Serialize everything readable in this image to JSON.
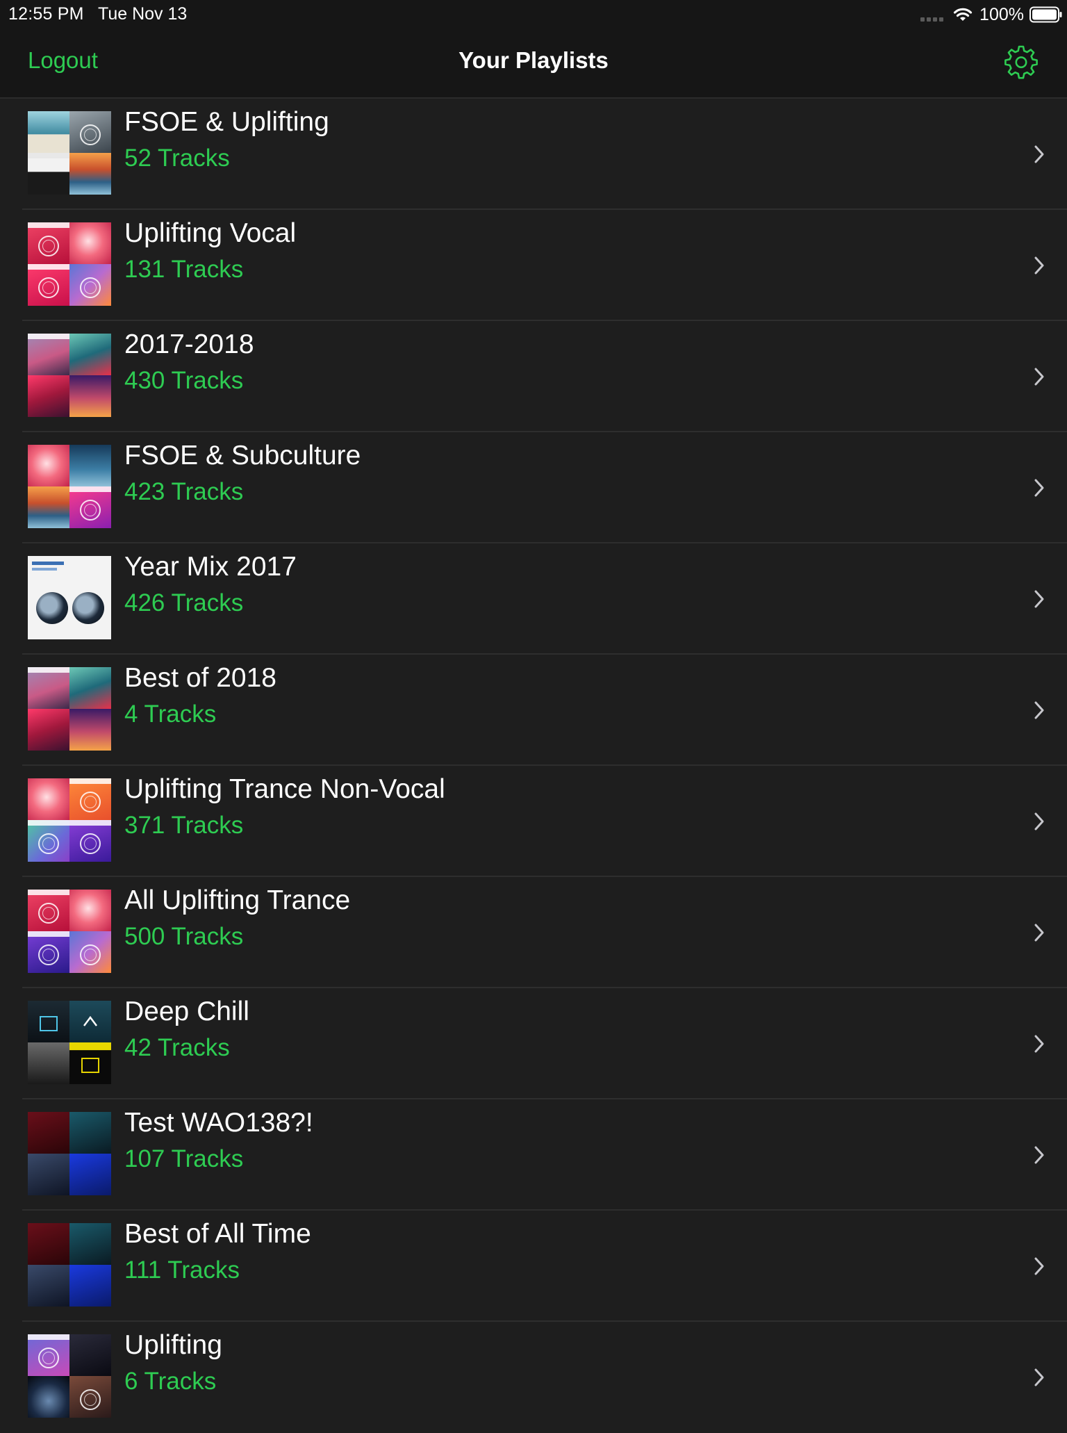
{
  "status_bar": {
    "time": "12:55 PM",
    "date": "Tue Nov 13",
    "battery_percent": "100%",
    "battery_level": 1.0,
    "icons": [
      "signal-dots-icon",
      "wifi-icon",
      "battery-icon"
    ]
  },
  "nav": {
    "logout_label": "Logout",
    "title": "Your Playlists",
    "settings_icon": "gear-icon",
    "accent_color": "#2ecc52"
  },
  "playlists": [
    {
      "title": "FSOE & Uplifting",
      "tracks": "52 Tracks"
    },
    {
      "title": "Uplifting Vocal",
      "tracks": "131 Tracks"
    },
    {
      "title": "2017-2018",
      "tracks": "430 Tracks"
    },
    {
      "title": "FSOE & Subculture",
      "tracks": "423 Tracks"
    },
    {
      "title": "Year Mix 2017",
      "tracks": "426 Tracks"
    },
    {
      "title": "Best of 2018",
      "tracks": "4 Tracks"
    },
    {
      "title": "Uplifting Trance Non-Vocal",
      "tracks": "371 Tracks"
    },
    {
      "title": "All Uplifting Trance",
      "tracks": "500 Tracks"
    },
    {
      "title": "Deep Chill",
      "tracks": "42 Tracks"
    },
    {
      "title": "Test WAO138?!",
      "tracks": "107 Tracks"
    },
    {
      "title": "Best of All Time",
      "tracks": "111 Tracks"
    },
    {
      "title": "Uplifting",
      "tracks": "6 Tracks"
    }
  ],
  "row_chevron_icon": "chevron-right-icon"
}
